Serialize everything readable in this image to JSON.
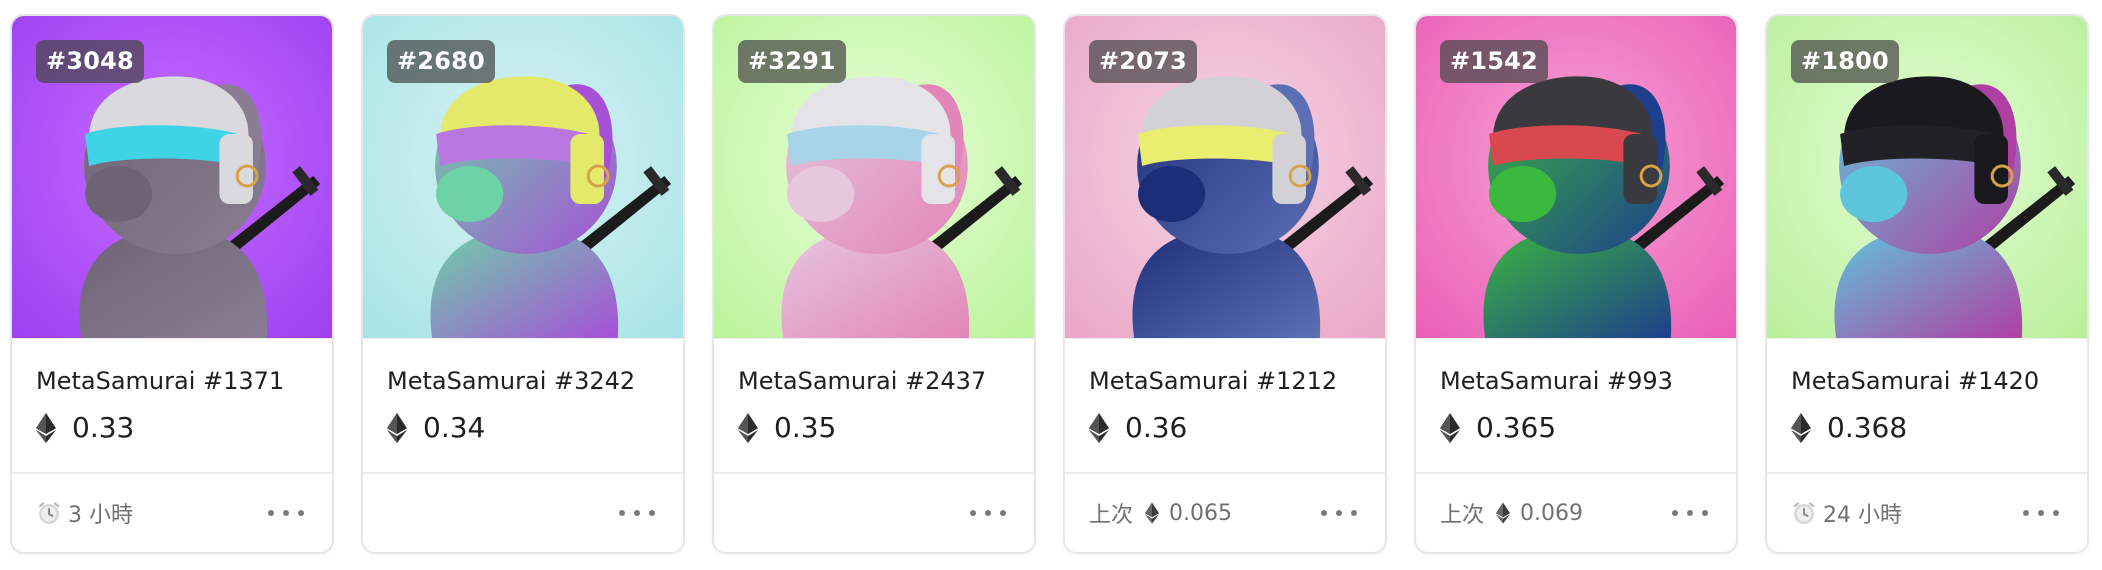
{
  "cards": [
    {
      "token_label": "#3048",
      "name": "MetaSamurai #1371",
      "price": "0.33",
      "footer_type": "time",
      "footer_prefix": "",
      "footer_value": "3 小時",
      "background": [
        "#c86cff",
        "#9b3ff2"
      ],
      "colors": {
        "body": "#6e6375",
        "helmet": "#d9d9de",
        "visor": "#3fd3e6",
        "accent": "#8a7d93"
      }
    },
    {
      "token_label": "#2680",
      "name": "MetaSamurai #3242",
      "price": "0.34",
      "footer_type": "none",
      "footer_prefix": "",
      "footer_value": "",
      "background": [
        "#d9f3f3",
        "#a6e3e6"
      ],
      "colors": {
        "body": "#6dd2a6",
        "helmet": "#e4e96a",
        "visor": "#b978e0",
        "accent": "#a650d8"
      }
    },
    {
      "token_label": "#3291",
      "name": "MetaSamurai #2437",
      "price": "0.35",
      "footer_type": "none",
      "footer_prefix": "",
      "footer_value": "",
      "background": [
        "#e9ffd8",
        "#b9f39a"
      ],
      "colors": {
        "body": "#e6c7de",
        "helmet": "#e4e4e8",
        "visor": "#a8d4ea",
        "accent": "#e285b8"
      }
    },
    {
      "token_label": "#2073",
      "name": "MetaSamurai #1212",
      "price": "0.36",
      "footer_type": "last",
      "footer_prefix": "上次",
      "footer_value": "0.065",
      "background": [
        "#f6d6e5",
        "#e9a6c6"
      ],
      "colors": {
        "body": "#1d2e78",
        "helmet": "#d2d2d6",
        "visor": "#e9ee6e",
        "accent": "#5c6fb5"
      }
    },
    {
      "token_label": "#1542",
      "name": "MetaSamurai #993",
      "price": "0.365",
      "footer_type": "last",
      "footer_prefix": "上次",
      "footer_value": "0.069",
      "background": [
        "#f8a2d6",
        "#ea5eb6"
      ],
      "colors": {
        "body": "#3bb83e",
        "helmet": "#3a3a3e",
        "visor": "#d8484e",
        "accent": "#1e3f8c"
      }
    },
    {
      "token_label": "#1800",
      "name": "MetaSamurai #1420",
      "price": "0.368",
      "footer_type": "time",
      "footer_prefix": "",
      "footer_value": "24 小時",
      "background": [
        "#e5ffd8",
        "#b8ee98"
      ],
      "colors": {
        "body": "#5ec6dc",
        "helmet": "#1a1a1e",
        "visor": "#222226",
        "accent": "#b03fa4"
      }
    }
  ]
}
